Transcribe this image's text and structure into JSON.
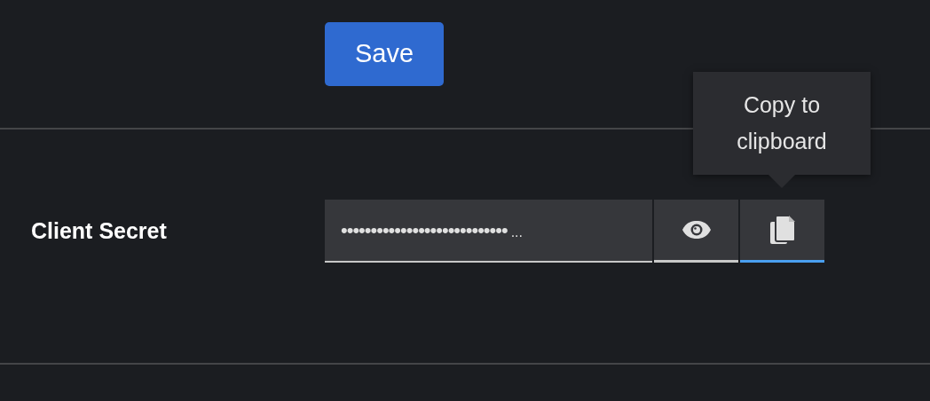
{
  "save_button": {
    "label": "Save"
  },
  "client_secret": {
    "label": "Client Secret",
    "value": "••••••••••••••••••••••••••••",
    "overflow": "...",
    "buttons": [
      {
        "kind": "show",
        "focused": false
      },
      {
        "kind": "copy",
        "focused": true
      }
    ],
    "tooltip": {
      "text": "Copy to clipboard"
    }
  }
}
